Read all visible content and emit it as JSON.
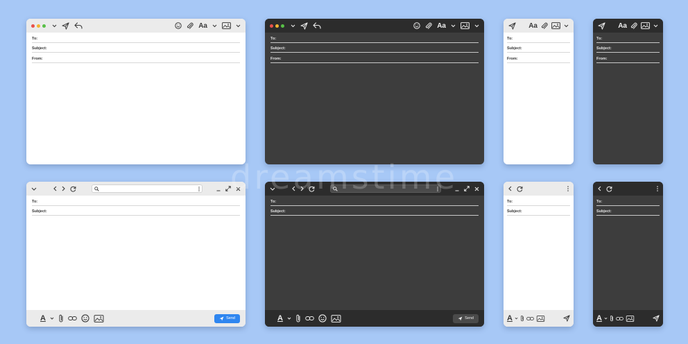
{
  "colors": {
    "background": "#a7c8f6",
    "light_window": "#ffffff",
    "dark_window": "#3d3d3d",
    "accent_blue": "#2f86f0",
    "traffic_red": "#e8514a",
    "traffic_yellow": "#f3b530",
    "traffic_green": "#58c047"
  },
  "labels": {
    "to": "To:",
    "subject": "Subject:",
    "from": "From:",
    "format": "Aa",
    "send": "Send",
    "font_style": "A"
  },
  "watermark": "dreamstime",
  "icons": [
    "send-icon",
    "reply-icon",
    "emoji-icon",
    "attachment-icon",
    "image-icon",
    "chevron-down-icon",
    "back-icon",
    "forward-icon",
    "refresh-icon",
    "search-icon",
    "minimize-icon",
    "expand-icon",
    "close-icon",
    "more-icon",
    "link-icon"
  ]
}
